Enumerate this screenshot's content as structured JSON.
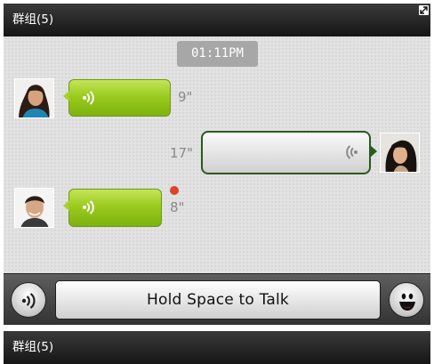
{
  "window": {
    "title": "群组(5)",
    "expand_icon": "expand-icon"
  },
  "chat": {
    "timestamp": "01:11PM",
    "messages": [
      {
        "sender": "other",
        "type": "voice",
        "duration": "9\"",
        "avatar": "woman-avatar",
        "unread": false
      },
      {
        "sender": "self",
        "type": "voice",
        "duration": "17\"",
        "avatar": "self-avatar",
        "unread": false
      },
      {
        "sender": "other",
        "type": "voice",
        "duration": "8\"",
        "avatar": "man-avatar",
        "unread": true
      }
    ]
  },
  "input_bar": {
    "voice_toggle_icon": "voice-wave-icon",
    "talk_label": "Hold Space to Talk",
    "emoji_icon": "smiley-icon"
  },
  "second_window": {
    "title": "群组(5)"
  },
  "colors": {
    "header_bg": "#1e1e1e",
    "bubble_green": "#9bcb1f",
    "bubble_border_self": "#2a5a1e",
    "unread_dot": "#d9442a",
    "chat_bg": "#e2e2e2"
  }
}
